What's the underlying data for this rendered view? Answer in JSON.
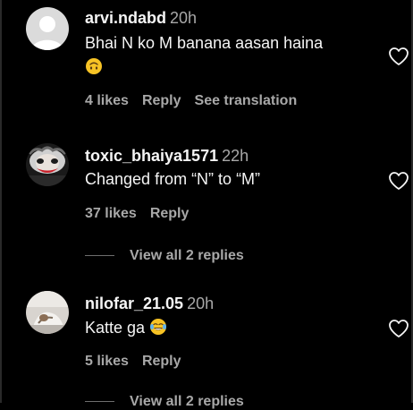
{
  "comments": [
    {
      "username": "arvi.ndabd",
      "time": "20h",
      "text": "Bhai N ko M banana aasan haina",
      "emoji": "upside-down-face",
      "likes": "4 likes",
      "reply": "Reply",
      "see_translation": "See translation",
      "avatar": "default-avatar"
    },
    {
      "username": "toxic_bhaiya1571",
      "time": "22h",
      "text": "Changed from “N” to “M”",
      "likes": "37 likes",
      "reply": "Reply",
      "avatar": "joker-avatar",
      "view_replies": "View all 2 replies"
    },
    {
      "username": "nilofar_21.05",
      "time": "20h",
      "text": "Katte ga",
      "emoji": "face-with-tears-of-joy",
      "likes": "5 likes",
      "reply": "Reply",
      "avatar": "photo-avatar",
      "view_replies": "View all 2 replies"
    }
  ],
  "colors": {
    "background": "#000000",
    "primary_text": "#f5f5f5",
    "secondary_text": "#a8a8a8",
    "emoji_yellow": "#f7c325"
  }
}
